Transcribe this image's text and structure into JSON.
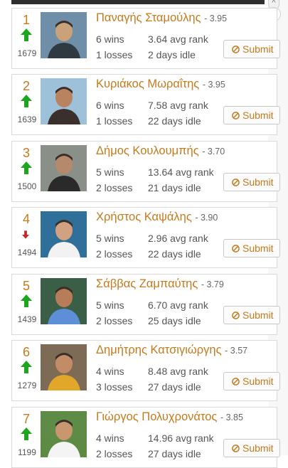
{
  "page": {
    "accent_color": "#c47a1c",
    "up_color": "#1ea51e",
    "down_color": "#c62828"
  },
  "scroll": {
    "up_glyph": "^",
    "down_glyph": "⌄"
  },
  "players": [
    {
      "rank": "1",
      "trend": "up",
      "rating": "1679",
      "name": "Παναγής Σταμούλης",
      "score": "- 3.95",
      "wins": "6 wins",
      "losses": "1 losses",
      "avg_rank": "3.64 avg rank",
      "idle": "2 days idle",
      "submit_label": "Submit",
      "submit_icon": "ban-icon"
    },
    {
      "rank": "2",
      "trend": "up",
      "rating": "1639",
      "name": "Κυριάκος Μωραΐτης",
      "score": "- 3.95",
      "wins": "6 wins",
      "losses": "1 losses",
      "avg_rank": "7.58 avg rank",
      "idle": "22 days idle",
      "submit_label": "Submit",
      "submit_icon": "ban-icon"
    },
    {
      "rank": "3",
      "trend": "up",
      "rating": "1500",
      "name": "Δήμος Κουλουμπής",
      "score": "- 3.70",
      "wins": "5 wins",
      "losses": "2 losses",
      "avg_rank": "13.64 avg rank",
      "idle": "21 days idle",
      "submit_label": "Submit",
      "submit_icon": "ban-icon"
    },
    {
      "rank": "4",
      "trend": "down",
      "rating": "1494",
      "name": "Χρήστος Καψάλης",
      "score": "- 3.90",
      "wins": "5 wins",
      "losses": "2 losses",
      "avg_rank": "2.96 avg rank",
      "idle": "22 days idle",
      "submit_label": "Submit",
      "submit_icon": "ban-icon"
    },
    {
      "rank": "5",
      "trend": "up",
      "rating": "1439",
      "name": "Σάββας Ζαμπαύτης",
      "score": "- 3.79",
      "wins": "5 wins",
      "losses": "2 losses",
      "avg_rank": "6.70 avg rank",
      "idle": "25 days idle",
      "submit_label": "Submit",
      "submit_icon": "ban-icon"
    },
    {
      "rank": "6",
      "trend": "up",
      "rating": "1279",
      "name": "Δημήτρης Κατσιγιώργης",
      "score": "- 3.57",
      "wins": "4 wins",
      "losses": "3 losses",
      "avg_rank": "8.48 avg rank",
      "idle": "27 days idle",
      "submit_label": "Submit",
      "submit_icon": "ban-icon"
    },
    {
      "rank": "7",
      "trend": "up",
      "rating": "1199",
      "name": "Γιώργος Πολυχρονάτος",
      "score": "- 3.85",
      "wins": "4 wins",
      "losses": "2 losses",
      "avg_rank": "14.96 avg rank",
      "idle": "27 days idle",
      "submit_label": "Submit",
      "submit_icon": "ban-icon"
    }
  ]
}
